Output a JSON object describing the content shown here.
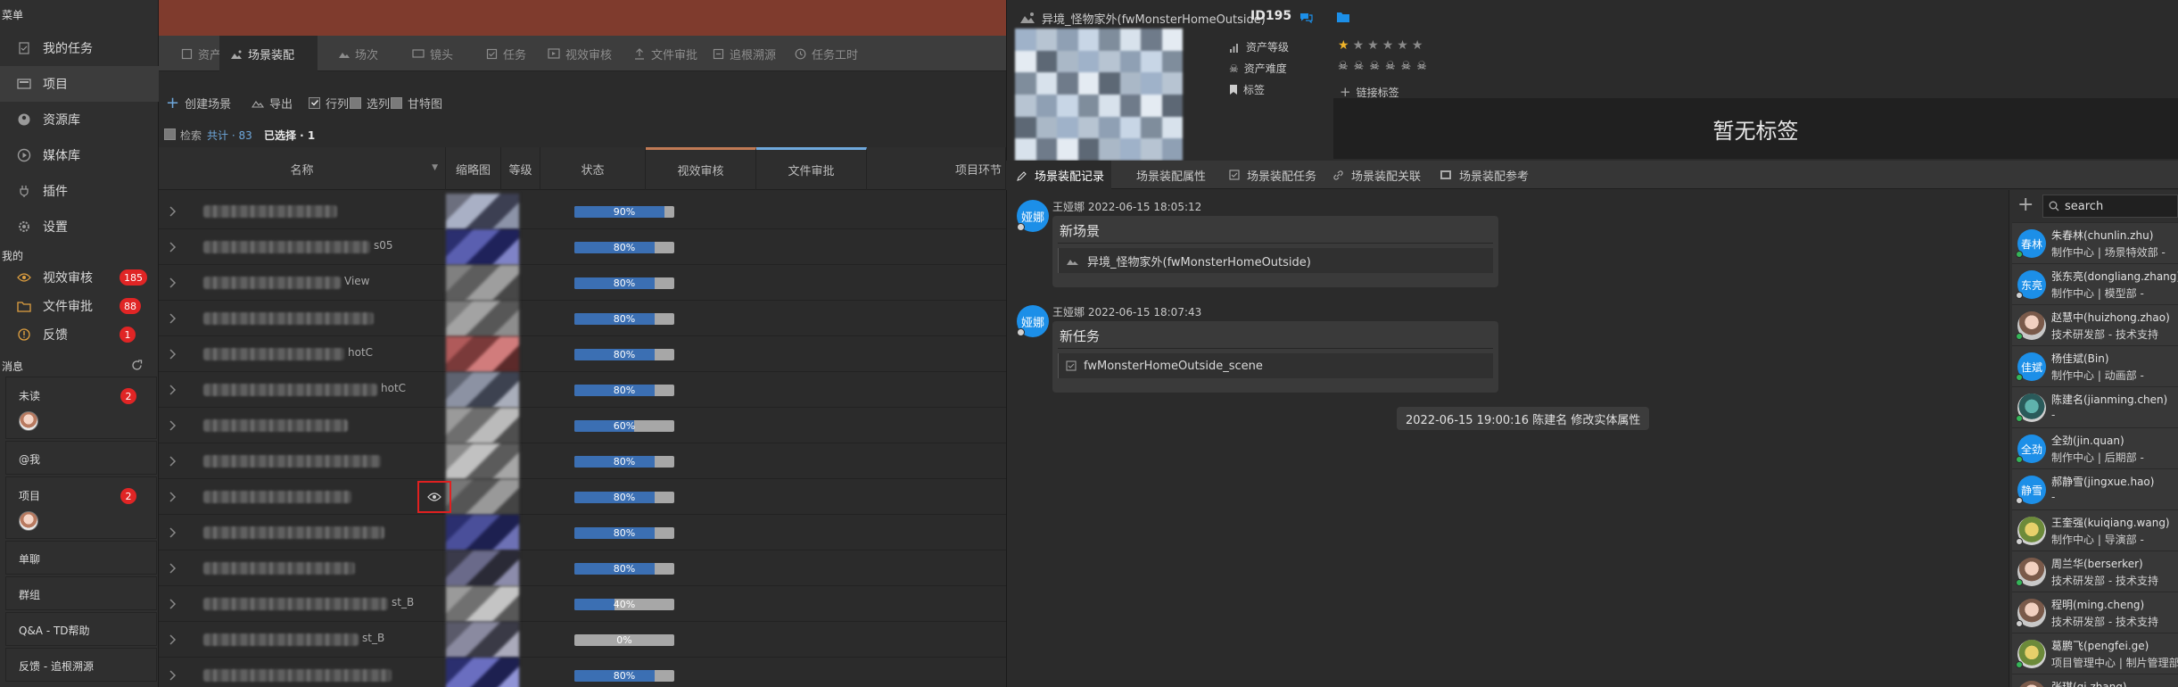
{
  "sidebar": {
    "menu_title": "菜单",
    "nav": [
      {
        "label": "我的任务",
        "icon": "task-icon"
      },
      {
        "label": "项目",
        "icon": "project-icon"
      },
      {
        "label": "资源库",
        "icon": "asset-library-icon"
      },
      {
        "label": "媒体库",
        "icon": "media-library-icon"
      },
      {
        "label": "插件",
        "icon": "plugin-icon"
      },
      {
        "label": "设置",
        "icon": "settings-icon"
      }
    ],
    "mine_title": "我的",
    "mine": [
      {
        "label": "视效审核",
        "count": "185"
      },
      {
        "label": "文件审批",
        "count": "88"
      },
      {
        "label": "反馈",
        "count": "1"
      }
    ],
    "msg_title": "消息",
    "msg_groups": [
      {
        "label": "未读",
        "count": "2"
      },
      {
        "label": "@我"
      },
      {
        "label": "项目",
        "count": "2"
      },
      {
        "label": "单聊"
      },
      {
        "label": "群组"
      },
      {
        "label": "Q&A - TD帮助"
      },
      {
        "label": "反馈 - 追根溯源"
      }
    ]
  },
  "tabs": [
    "资产",
    "场景装配",
    "场次",
    "镜头",
    "任务",
    "视效审核",
    "文件审批",
    "追根溯源",
    "任务工时"
  ],
  "toolbar": {
    "create": "创建场景",
    "export": "导出",
    "rows": "行列",
    "cols": "选列",
    "gantt": "甘特图"
  },
  "filter": {
    "search": "检索",
    "total_label": "共计 · 83",
    "selected_label": "已选择 · 1"
  },
  "grid": {
    "columns": [
      "名称",
      "缩略图",
      "等级",
      "状态",
      "视效审核",
      "文件审批",
      "项目环节"
    ],
    "column_colors": {
      "vfx": "#c07a55",
      "file": "#6fa8dc"
    },
    "rows": [
      {
        "suffix": "",
        "progress": 90
      },
      {
        "suffix": "s05",
        "progress": 80
      },
      {
        "suffix": "View",
        "progress": 80
      },
      {
        "suffix": "",
        "progress": 80
      },
      {
        "suffix": "hotC",
        "progress": 80
      },
      {
        "suffix": "hotC",
        "progress": 80
      },
      {
        "suffix": "",
        "progress": 60
      },
      {
        "suffix": "",
        "progress": 80
      },
      {
        "suffix": "",
        "progress": 80,
        "preview": true
      },
      {
        "suffix": "",
        "progress": 80
      },
      {
        "suffix": "",
        "progress": 80
      },
      {
        "suffix": "st_B",
        "progress": 40
      },
      {
        "suffix": "st_B",
        "progress": 0
      },
      {
        "suffix": "",
        "progress": 80
      }
    ]
  },
  "detail": {
    "title": "异境_怪物家外(fwMonsterHomeOutside)",
    "id_label": "ID195",
    "asset_level_label": "资产等级",
    "asset_difficulty_label": "资产难度",
    "tag_label": "标签",
    "level_stars": 1,
    "difficulty_skulls": 6,
    "link_tag": "链接标签",
    "no_tag": "暂无标签"
  },
  "subtabs": [
    "场景装配记录",
    "场景装配属性",
    "场景装配任务",
    "场景装配关联",
    "场景装配参考"
  ],
  "feed": [
    {
      "avatar": "娅娜",
      "meta": "王娅娜 2022-06-15 18:05:12",
      "title": "新场景",
      "body": "异境_怪物家外(fwMonsterHomeOutside)"
    },
    {
      "avatar": "娅娜",
      "meta": "王娅娜 2022-06-15 18:07:43",
      "title": "新任务",
      "body": "fwMonsterHomeOutside_scene"
    }
  ],
  "system_note": "2022-06-15 19:00:16 陈建名 修改实体属性",
  "members": {
    "search_placeholder": "search",
    "list": [
      {
        "avatar": "春林",
        "name": "朱春林(chunlin.zhu)",
        "dept": "制作中心 | 场景特效部 -",
        "style": "blue",
        "status": "#35b558"
      },
      {
        "avatar": "东亮",
        "name": "张东亮(dongliang.zhang)",
        "dept": "制作中心 | 模型部 -",
        "style": "blue",
        "status": "#d0d0d0"
      },
      {
        "avatar": "",
        "name": "赵慧中(huizhong.zhao)",
        "dept": "技术研发部 - 技术支持",
        "style": "photo",
        "status": "#35b558"
      },
      {
        "avatar": "佳斌",
        "name": "杨佳斌(Bin)",
        "dept": "制作中心 | 动画部 -",
        "style": "blue",
        "status": "#35b558"
      },
      {
        "avatar": "",
        "name": "陈建名(jianming.chen)",
        "dept": "-",
        "style": "teal",
        "status": "#35b558"
      },
      {
        "avatar": "全劲",
        "name": "全劲(jin.quan)",
        "dept": "制作中心 | 后期部 -",
        "style": "blue",
        "status": "#35b558"
      },
      {
        "avatar": "静雪",
        "name": "郝静雪(jingxue.hao)",
        "dept": "-",
        "style": "blue",
        "status": "#d0d0d0"
      },
      {
        "avatar": "",
        "name": "王奎强(kuiqiang.wang)",
        "dept": "制作中心 | 导演部 -",
        "style": "green",
        "status": "#d0d0d0"
      },
      {
        "avatar": "",
        "name": "周兰华(berserker)",
        "dept": "技术研发部 - 技术支持",
        "style": "photo",
        "status": "#35b558"
      },
      {
        "avatar": "",
        "name": "程明(ming.cheng)",
        "dept": "技术研发部 - 技术支持",
        "style": "photo",
        "status": "#d0d0d0"
      },
      {
        "avatar": "",
        "name": "葛鹏飞(pengfei.ge)",
        "dept": "项目管理中心 | 制片管理部",
        "style": "green",
        "status": "#35b558"
      },
      {
        "avatar": "",
        "name": "张琪(qi.zhang)",
        "dept": "",
        "style": "photo",
        "status": "#d0d0d0"
      }
    ]
  }
}
